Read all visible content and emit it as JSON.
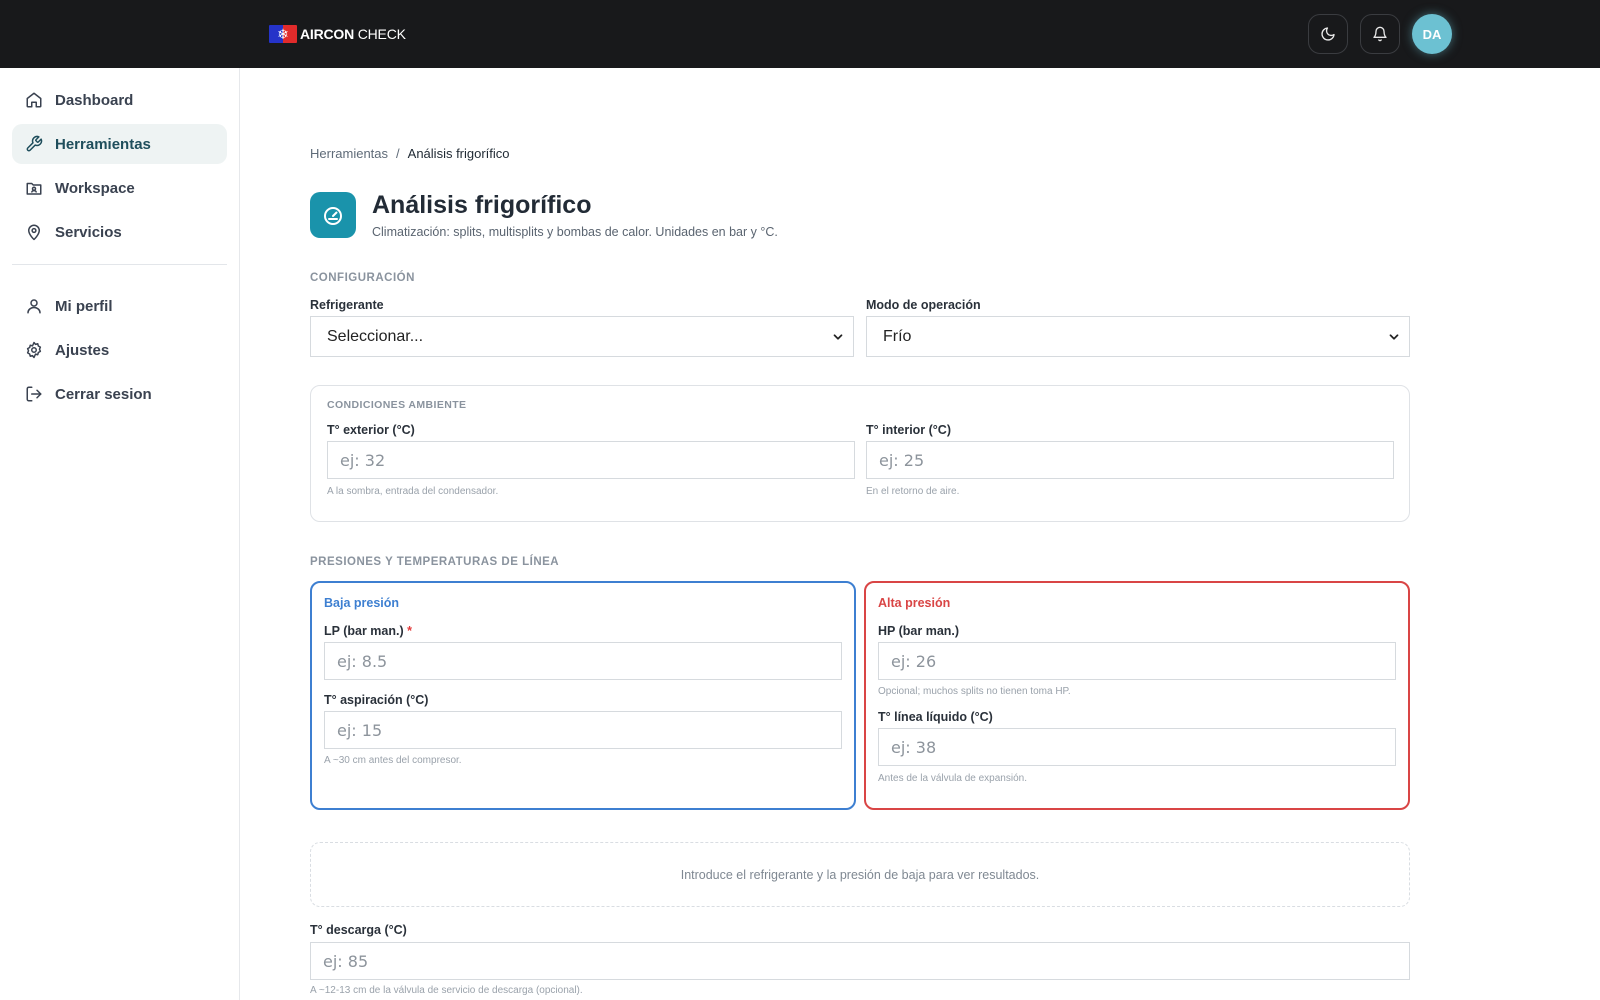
{
  "app": {
    "logo_bold": "AIRCON",
    "logo_light": "CHECK",
    "avatar_initials": "DA"
  },
  "sidebar": {
    "items": [
      {
        "label": "Dashboard",
        "icon": "home-icon"
      },
      {
        "label": "Herramientas",
        "icon": "wrench-icon",
        "active": true
      },
      {
        "label": "Workspace",
        "icon": "workspace-icon"
      },
      {
        "label": "Servicios",
        "icon": "map-pin-icon"
      },
      {
        "label": "Mi perfil",
        "icon": "user-icon"
      },
      {
        "label": "Ajustes",
        "icon": "gear-icon"
      },
      {
        "label": "Cerrar sesion",
        "icon": "logout-icon"
      }
    ]
  },
  "breadcrumb": {
    "parent": "Herramientas",
    "separator": "/",
    "current": "Análisis frigorífico"
  },
  "page": {
    "title": "Análisis frigorífico",
    "subtitle": "Climatización: splits, multisplits y bombas de calor. Unidades en bar y °C."
  },
  "config": {
    "heading": "CONFIGURACIÓN",
    "refrigerant_label": "Refrigerante",
    "refrigerant_value": "Seleccionar...",
    "mode_label": "Modo de operación",
    "mode_value": "Frío"
  },
  "ambient": {
    "heading": "CONDICIONES AMBIENTE",
    "ext_label": "T° exterior (°C)",
    "ext_placeholder": "ej: 32",
    "ext_hint": "A la sombra, entrada del condensador.",
    "int_label": "T° interior (°C)",
    "int_placeholder": "ej: 25",
    "int_hint": "En el retorno de aire."
  },
  "lines": {
    "heading": "PRESIONES Y TEMPERATURAS DE LÍNEA",
    "low": {
      "title": "Baja presión",
      "lp_label": "LP (bar man.)",
      "lp_required": "*",
      "lp_placeholder": "ej: 8.5",
      "suction_label": "T° aspiración (°C)",
      "suction_placeholder": "ej: 15",
      "suction_hint": "A ~30 cm antes del compresor."
    },
    "high": {
      "title": "Alta presión",
      "hp_label": "HP (bar man.)",
      "hp_placeholder": "ej: 26",
      "hp_hint": "Opcional; muchos splits no tienen toma HP.",
      "liquid_label": "T° línea líquido (°C)",
      "liquid_placeholder": "ej: 38",
      "liquid_hint": "Antes de la válvula de expansión."
    }
  },
  "results": {
    "empty_message": "Introduce el refrigerante y la presión de baja para ver resultados."
  },
  "discharge": {
    "label": "T° descarga (°C)",
    "placeholder": "ej: 85",
    "hint": "A ~12-13 cm de la válvula de servicio de descarga (opcional)."
  },
  "colors": {
    "accent": "#1a93ab",
    "low_pressure": "#3d7fd1",
    "high_pressure": "#d94545",
    "topbar": "#18191b",
    "avatar": "#6cc1d2"
  }
}
